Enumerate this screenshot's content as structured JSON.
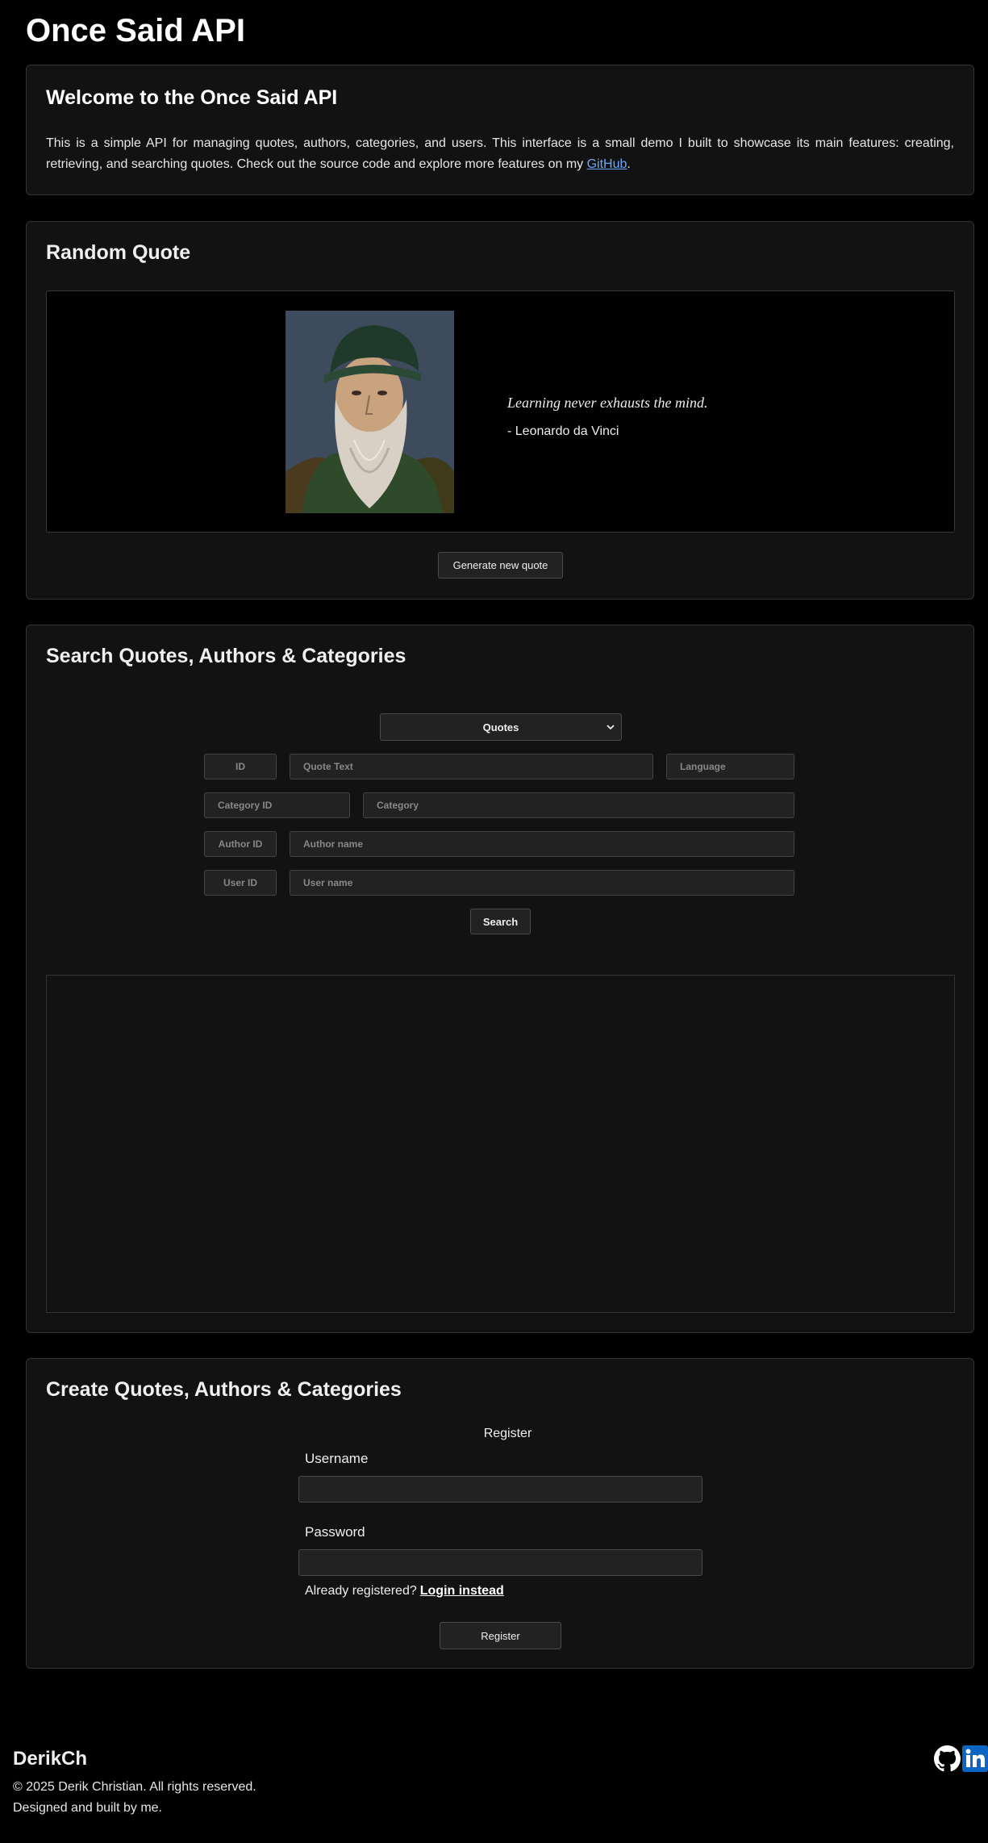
{
  "header": {
    "title": "Once Said API"
  },
  "welcome": {
    "heading": "Welcome to the Once Said API",
    "body": "This is a simple API for managing quotes, authors, categories, and users. This interface is a small demo I built to showcase its main features: creating, retrieving, and searching quotes. Check out the source code and explore more features on my ",
    "link_text": "GitHub",
    "body_end": "."
  },
  "random_quote": {
    "heading": "Random Quote",
    "quote": "Learning never exhausts the mind.",
    "author": "- Leonardo da Vinci",
    "button": "Generate new quote",
    "portrait_icon": "portrait-image"
  },
  "search": {
    "heading": "Search Quotes, Authors & Categories",
    "select_value": "Quotes",
    "fields": {
      "id": "ID",
      "quote_text": "Quote Text",
      "language": "Language",
      "category_id": "Category ID",
      "category": "Category",
      "author_id": "Author ID",
      "author_name": "Author name",
      "user_id": "User ID",
      "user_name": "User name"
    },
    "button": "Search"
  },
  "create": {
    "heading": "Create Quotes, Authors & Categories",
    "form_title": "Register",
    "username_label": "Username",
    "password_label": "Password",
    "already_text": "Already registered?",
    "login_link": "Login instead",
    "button": "Register"
  },
  "footer": {
    "brand": "DerikCh",
    "copyright": "© 2025 Derik Christian. All rights reserved.",
    "tagline": "Designed and built by me.",
    "icons": [
      "github-icon",
      "linkedin-icon"
    ]
  },
  "colors": {
    "background": "#000000",
    "card": "#121212",
    "link": "#6ea8fe",
    "linkedin": "#0a66c2"
  }
}
